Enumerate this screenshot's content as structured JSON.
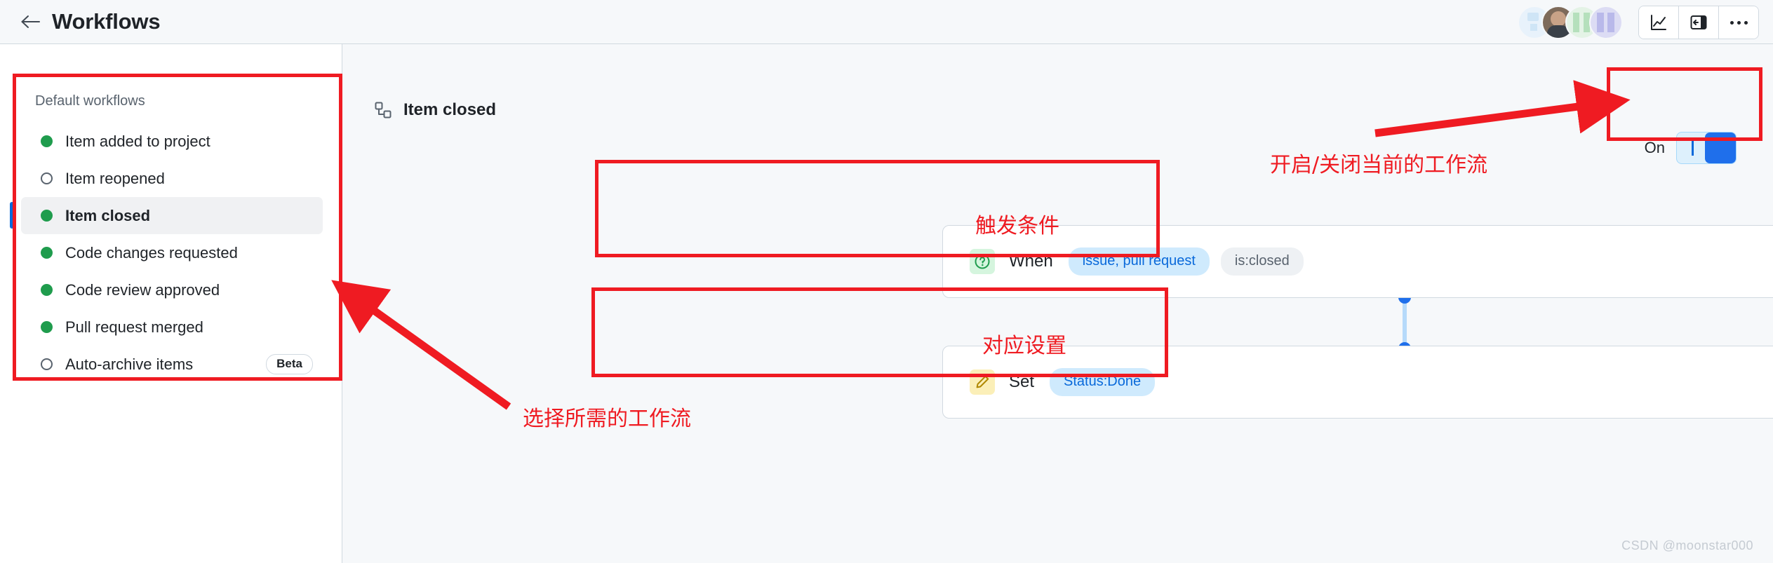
{
  "topbar": {
    "back_icon": "arrow-left-icon",
    "title": "Workflows",
    "avatars": [
      "avatar-1",
      "avatar-2",
      "avatar-3",
      "avatar-4"
    ],
    "buttons": [
      {
        "name": "insights-button",
        "icon": "line-chart-icon"
      },
      {
        "name": "toggle-sidepanel-button",
        "icon": "side-panel-icon"
      },
      {
        "name": "more-options-button",
        "icon": "kebab-menu-icon"
      }
    ]
  },
  "sidebar": {
    "heading": "Default workflows",
    "items": [
      {
        "label": "Item added to project",
        "state": "on",
        "selected": false,
        "badge": ""
      },
      {
        "label": "Item reopened",
        "state": "off",
        "selected": false,
        "badge": ""
      },
      {
        "label": "Item closed",
        "state": "on",
        "selected": true,
        "badge": ""
      },
      {
        "label": "Code changes requested",
        "state": "on",
        "selected": false,
        "badge": ""
      },
      {
        "label": "Code review approved",
        "state": "on",
        "selected": false,
        "badge": ""
      },
      {
        "label": "Pull request merged",
        "state": "on",
        "selected": false,
        "badge": ""
      },
      {
        "label": "Auto-archive items",
        "state": "off",
        "selected": false,
        "badge": "Beta"
      }
    ]
  },
  "content": {
    "header_icon": "workflow-icon",
    "title": "Item closed",
    "toggle": {
      "label": "On",
      "state": "on"
    },
    "cards": [
      {
        "icon": "question-circle-icon",
        "icon_color": "#1f9c4d",
        "verb": "When",
        "chips": [
          {
            "text": "issue, pull request",
            "style": "blue"
          },
          {
            "text": "is:closed",
            "style": "gray"
          }
        ]
      },
      {
        "icon": "pencil-icon",
        "icon_color": "#b08800",
        "verb": "Set",
        "chips": [
          {
            "text": "Status:Done",
            "style": "blue"
          }
        ]
      }
    ]
  },
  "annotations": {
    "color": "#ef1b22",
    "trigger_condition": "触发条件",
    "corresponding_setting": "对应设置",
    "select_workflow": "选择所需的工作流",
    "enable_disable_workflow": "开启/关闭当前的工作流"
  },
  "watermark": "CSDN @moonstar000"
}
